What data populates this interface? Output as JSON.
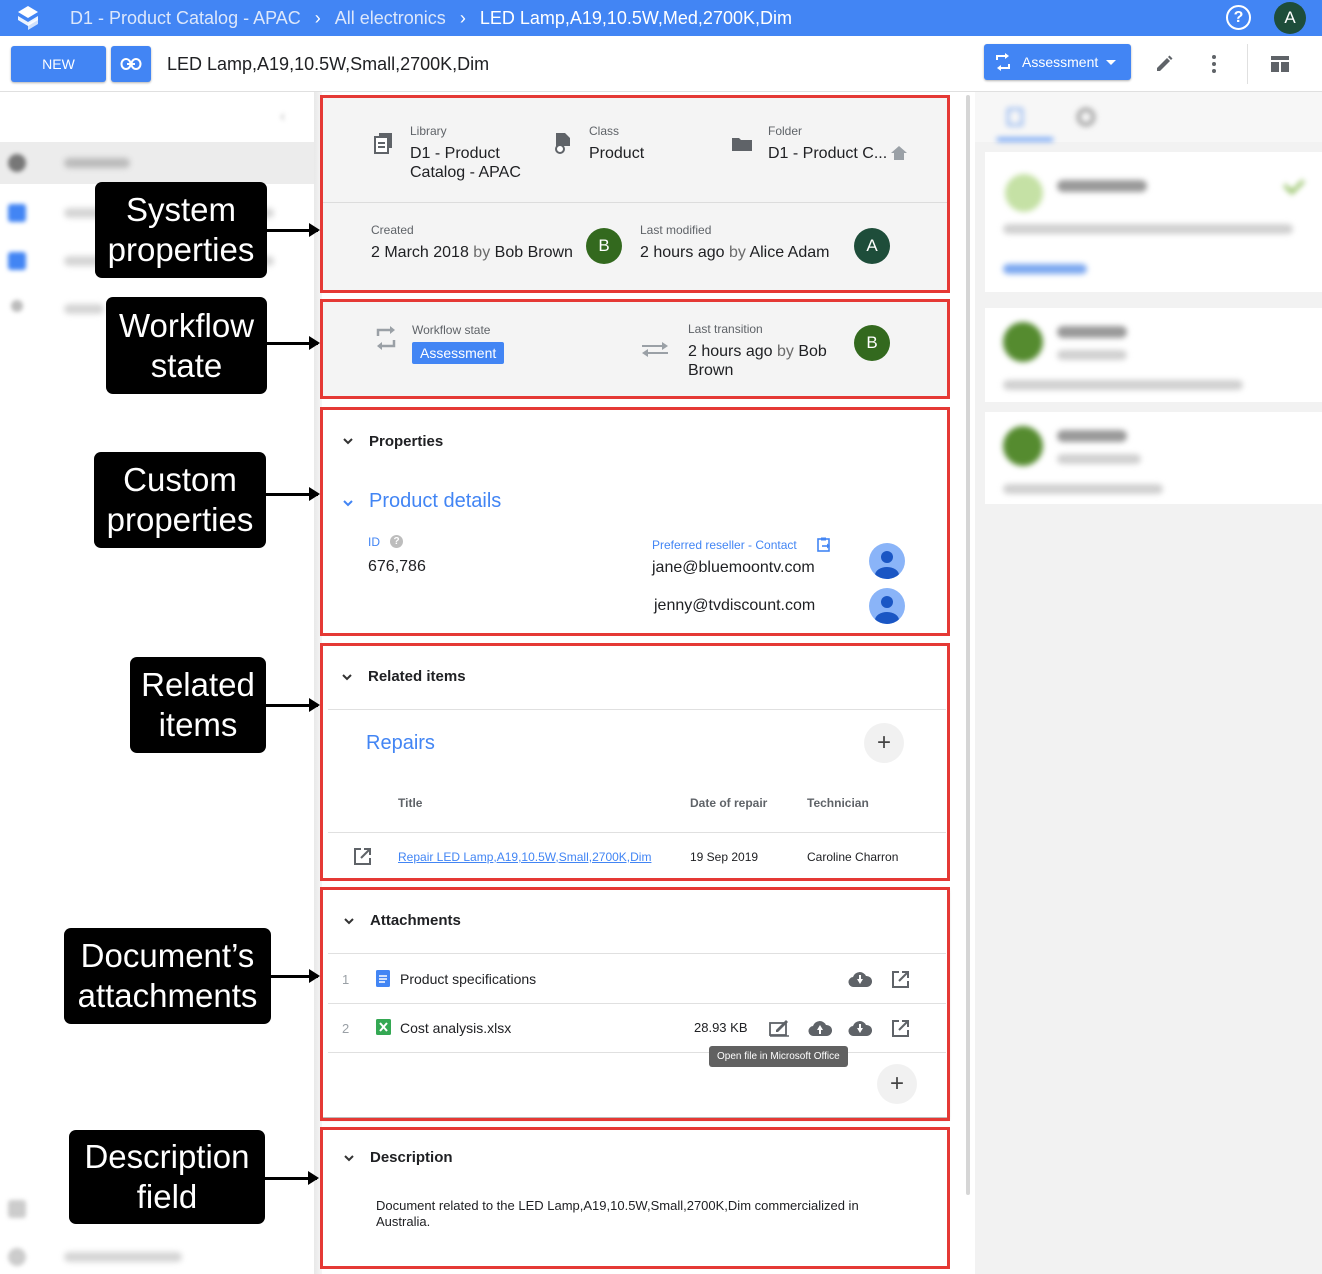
{
  "topbar": {
    "breadcrumb": [
      "D1 - Product Catalog - APAC",
      "All electronics",
      "LED Lamp,A19,10.5W,Med,2700K,Dim"
    ],
    "help_label": "?",
    "user_initial": "A"
  },
  "toolbar": {
    "new_label": "NEW",
    "document_title": "LED Lamp,A19,10.5W,Small,2700K,Dim",
    "workflow_button_label": "Assessment"
  },
  "system_properties": {
    "library_label": "Library",
    "library_value": "D1 - Product Catalog - APAC",
    "class_label": "Class",
    "class_value": "Product",
    "folder_label": "Folder",
    "folder_value": "D1 - Product C...",
    "created_label": "Created",
    "created_date": "2 March 2018",
    "created_by_word": "by",
    "created_by": "Bob Brown",
    "created_initial": "B",
    "modified_label": "Last modified",
    "modified_date": "2 hours ago",
    "modified_by_word": "by",
    "modified_by": "Alice Adam",
    "modified_initial": "A"
  },
  "workflow": {
    "state_label": "Workflow state",
    "state_value": "Assessment",
    "transition_label": "Last transition",
    "transition_date": "2 hours ago",
    "transition_by_word": "by",
    "transition_by_first": "Bob",
    "transition_by_last": "Brown",
    "transition_initial": "B"
  },
  "properties": {
    "section_title": "Properties",
    "group_title": "Product details",
    "id_label": "ID",
    "id_value": "676,786",
    "reseller_label": "Preferred reseller - Contact",
    "contacts": [
      "jane@bluemoontv.com",
      "jenny@tvdiscount.com"
    ]
  },
  "related": {
    "section_title": "Related items",
    "group_title": "Repairs",
    "columns": [
      "Title",
      "Date of repair",
      "Technician"
    ],
    "rows": [
      {
        "title": "Repair LED Lamp,A19,10.5W,Small,2700K,Dim",
        "date": "19 Sep 2019",
        "technician": "Caroline Charron"
      }
    ]
  },
  "attachments": {
    "section_title": "Attachments",
    "items": [
      {
        "index": "1",
        "name": "Product specifications",
        "size": ""
      },
      {
        "index": "2",
        "name": "Cost analysis.xlsx",
        "size": "28.93 KB"
      }
    ],
    "tooltip": "Open file in Microsoft Office"
  },
  "description": {
    "section_title": "Description",
    "text": "Document related to the LED Lamp,A19,10.5W,Small,2700K,Dim commercialized in Australia."
  },
  "callouts": {
    "system": "System properties",
    "workflow": "Workflow state",
    "custom": "Custom properties",
    "related": "Related items",
    "attachments": "Document’s attachments",
    "description": "Description field"
  },
  "colors": {
    "brand_blue": "#4285f4",
    "highlight_red": "#e53935",
    "avatar_green": "#33691e",
    "avatar_dark": "#1e4d3a"
  }
}
